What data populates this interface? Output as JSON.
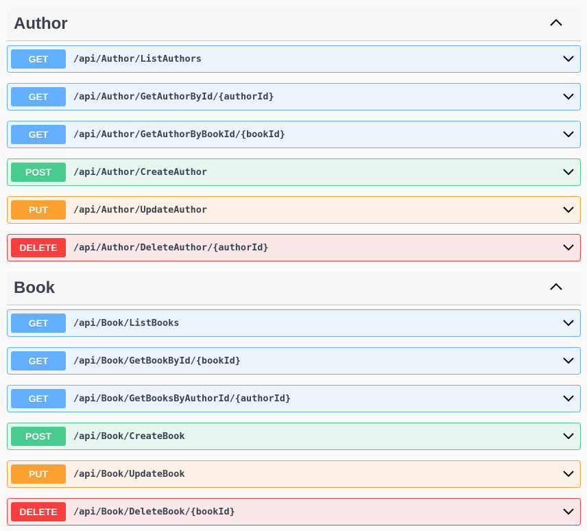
{
  "sections": [
    {
      "title": "Author",
      "operations": [
        {
          "method": "GET",
          "path": "/api/Author/ListAuthors"
        },
        {
          "method": "GET",
          "path": "/api/Author/GetAuthorById/{authorId}"
        },
        {
          "method": "GET",
          "path": "/api/Author/GetAuthorByBookId/{bookId}"
        },
        {
          "method": "POST",
          "path": "/api/Author/CreateAuthor"
        },
        {
          "method": "PUT",
          "path": "/api/Author/UpdateAuthor"
        },
        {
          "method": "DELETE",
          "path": "/api/Author/DeleteAuthor/{authorId}"
        }
      ]
    },
    {
      "title": "Book",
      "operations": [
        {
          "method": "GET",
          "path": "/api/Book/ListBooks"
        },
        {
          "method": "GET",
          "path": "/api/Book/GetBookById/{bookId}"
        },
        {
          "method": "GET",
          "path": "/api/Book/GetBooksByAuthorId/{authorId}"
        },
        {
          "method": "POST",
          "path": "/api/Book/CreateBook"
        },
        {
          "method": "PUT",
          "path": "/api/Book/UpdateBook"
        },
        {
          "method": "DELETE",
          "path": "/api/Book/DeleteBook/{bookId}"
        }
      ]
    }
  ],
  "icons": {
    "section_toggle": "chevron-up-icon",
    "operation_toggle": "chevron-down-icon"
  },
  "colors": {
    "get": "#61affe",
    "post": "#49cc90",
    "put": "#fca130",
    "delete": "#f93e3e",
    "text": "#3b4151"
  }
}
